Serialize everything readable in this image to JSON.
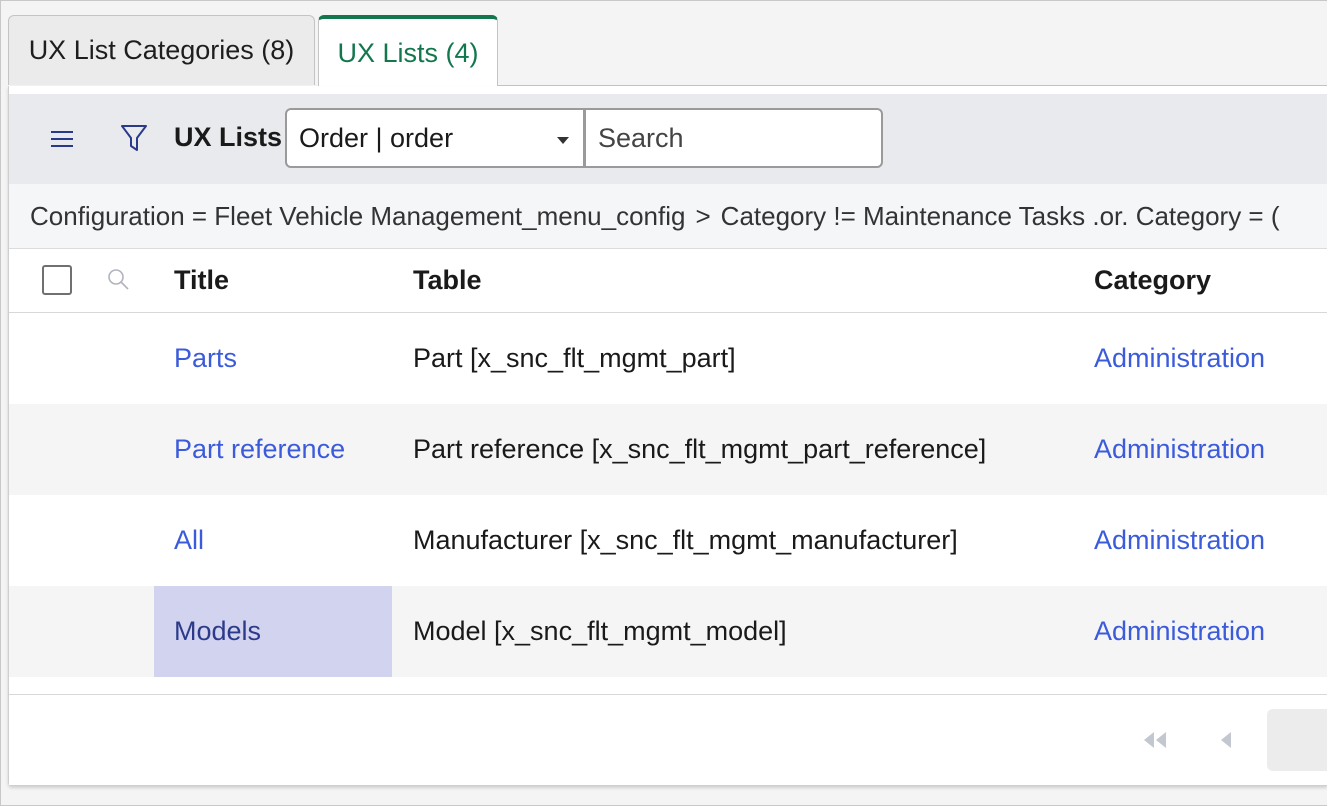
{
  "tabs": [
    {
      "label": "UX List Categories (8)",
      "active": false
    },
    {
      "label": "UX Lists (4)",
      "active": true
    }
  ],
  "toolbar": {
    "menu_icon": "hamburger-menu-icon",
    "filter_icon": "funnel-icon",
    "title": "UX Lists",
    "select_value": "Order | order",
    "search_placeholder": "Search"
  },
  "breadcrumb": {
    "first": "Configuration = Fleet Vehicle Management_menu_config",
    "separator": ">",
    "second": "Category != Maintenance Tasks .or. Category = ("
  },
  "columns": {
    "title": "Title",
    "table": "Table",
    "category": "Category"
  },
  "rows": [
    {
      "title": "Parts",
      "table": "Part [x_snc_flt_mgmt_part]",
      "category": "Administration"
    },
    {
      "title": "Part reference",
      "table": "Part reference [x_snc_flt_mgmt_part_reference]",
      "category": "Administration"
    },
    {
      "title": "All",
      "table": "Manufacturer [x_snc_flt_mgmt_manufacturer]",
      "category": "Administration"
    },
    {
      "title": "Models",
      "table": "Model [x_snc_flt_mgmt_model]",
      "category": "Administration"
    }
  ],
  "colors": {
    "active_tab": "#13774d",
    "link": "#3b5bdb",
    "highlight": "#d2d3ef"
  }
}
